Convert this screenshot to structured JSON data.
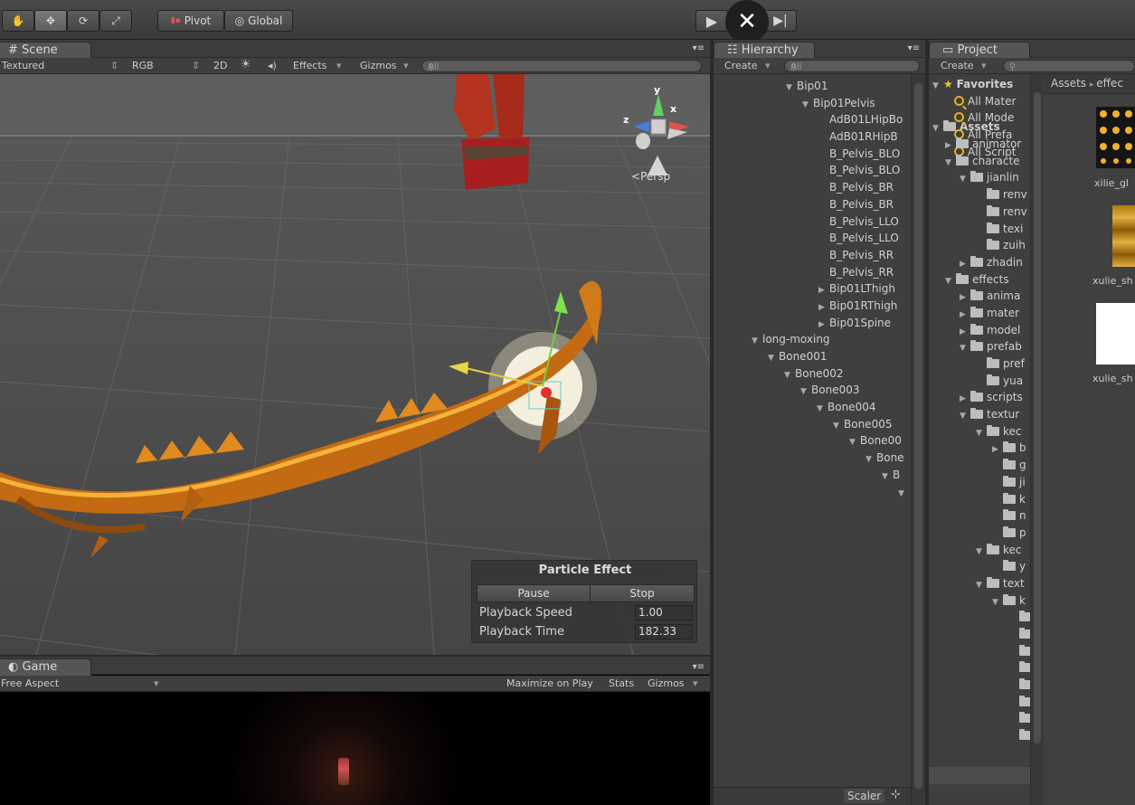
{
  "toolbar": {
    "pivot_label": "Pivot",
    "global_label": "Global",
    "play_icon": "play-icon",
    "close_icon": "close-icon",
    "step_icon": "step-icon"
  },
  "scene": {
    "tab_label": "Scene",
    "draw_mode": "Textured",
    "color_mode": "RGB",
    "mode_2d": "2D",
    "effects_label": "Effects",
    "gizmos_label": "Gizmos",
    "search_placeholder": "All",
    "persp_label": "Persp",
    "axis_x": "x",
    "axis_y": "y",
    "axis_z": "z"
  },
  "particle_effect": {
    "title": "Particle Effect",
    "pause_label": "Pause",
    "stop_label": "Stop",
    "speed_label": "Playback Speed",
    "speed_value": "1.00",
    "time_label": "Playback Time",
    "time_value": "182.33"
  },
  "game": {
    "tab_label": "Game",
    "aspect": "Free Aspect",
    "maximize_label": "Maximize on Play",
    "stats_label": "Stats",
    "gizmos_label": "Gizmos"
  },
  "hierarchy": {
    "tab_label": "Hierarchy",
    "create_label": "Create",
    "search_placeholder": "All",
    "items": [
      {
        "label": "Bip01",
        "expanded": true
      },
      {
        "label": "Bip01Pelvis",
        "expanded": true
      },
      {
        "label": "AdB01LHipBo",
        "expanded": null
      },
      {
        "label": "AdB01RHipB",
        "expanded": null
      },
      {
        "label": "B_Pelvis_BLO",
        "expanded": null
      },
      {
        "label": "B_Pelvis_BLO",
        "expanded": null
      },
      {
        "label": "B_Pelvis_BR",
        "expanded": null
      },
      {
        "label": "B_Pelvis_BR",
        "expanded": null
      },
      {
        "label": "B_Pelvis_LLO",
        "expanded": null
      },
      {
        "label": "B_Pelvis_LLO",
        "expanded": null
      },
      {
        "label": "B_Pelvis_RR",
        "expanded": null
      },
      {
        "label": "B_Pelvis_RR",
        "expanded": null
      },
      {
        "label": "Bip01LThigh",
        "expanded": false
      },
      {
        "label": "Bip01RThigh",
        "expanded": false
      },
      {
        "label": "Bip01Spine",
        "expanded": false
      },
      {
        "label": "long-moxing",
        "expanded": true
      },
      {
        "label": "Bone001",
        "expanded": true
      },
      {
        "label": "Bone002",
        "expanded": true
      },
      {
        "label": "Bone003",
        "expanded": true
      },
      {
        "label": "Bone004",
        "expanded": true
      },
      {
        "label": "Bone005",
        "expanded": true
      },
      {
        "label": "Bone00",
        "expanded": true
      },
      {
        "label": "Bone",
        "expanded": true
      },
      {
        "label": "B",
        "expanded": true
      },
      {
        "label": "",
        "expanded": true
      }
    ],
    "scaler_label": "Scaler"
  },
  "project": {
    "tab_label": "Project",
    "create_label": "Create",
    "breadcrumb": [
      "Assets",
      "effec"
    ],
    "favorites_label": "Favorites",
    "favorites": [
      "All Mater",
      "All Mode",
      "All Prefa",
      "All Script"
    ],
    "assets_label": "Assets",
    "folders": [
      {
        "label": "animator",
        "expanded": false
      },
      {
        "label": "characte",
        "expanded": true
      },
      {
        "label": "jianlin",
        "expanded": true
      },
      {
        "label": "renv",
        "expanded": null
      },
      {
        "label": "renv",
        "expanded": null
      },
      {
        "label": "texi",
        "expanded": null
      },
      {
        "label": "zuih",
        "expanded": null
      },
      {
        "label": "zhadin",
        "expanded": false
      },
      {
        "label": "effects",
        "expanded": true
      },
      {
        "label": "anima",
        "expanded": false
      },
      {
        "label": "mater",
        "expanded": false
      },
      {
        "label": "model",
        "expanded": false
      },
      {
        "label": "prefab",
        "expanded": true
      },
      {
        "label": "pref",
        "expanded": null
      },
      {
        "label": "yua",
        "expanded": null
      },
      {
        "label": "scripts",
        "expanded": false
      },
      {
        "label": "textur",
        "expanded": true
      },
      {
        "label": "kec",
        "expanded": true
      },
      {
        "label": "b",
        "expanded": false
      },
      {
        "label": "g",
        "expanded": null
      },
      {
        "label": "ji",
        "expanded": null
      },
      {
        "label": "k",
        "expanded": null
      },
      {
        "label": "n",
        "expanded": null
      },
      {
        "label": "p",
        "expanded": null
      },
      {
        "label": "kec",
        "expanded": true
      },
      {
        "label": "y",
        "expanded": null
      },
      {
        "label": "text",
        "expanded": true
      },
      {
        "label": "k",
        "expanded": true
      },
      {
        "label": "",
        "expanded": null
      },
      {
        "label": "",
        "expanded": null
      },
      {
        "label": "",
        "expanded": null
      },
      {
        "label": "",
        "expanded": null
      },
      {
        "label": "",
        "expanded": null
      },
      {
        "label": "",
        "expanded": null
      },
      {
        "label": "",
        "expanded": null
      },
      {
        "label": "",
        "expanded": null
      }
    ],
    "assets": [
      {
        "label": "xilie_gl"
      },
      {
        "label": "xulie_sh"
      },
      {
        "label": "xulie_sh"
      }
    ]
  }
}
